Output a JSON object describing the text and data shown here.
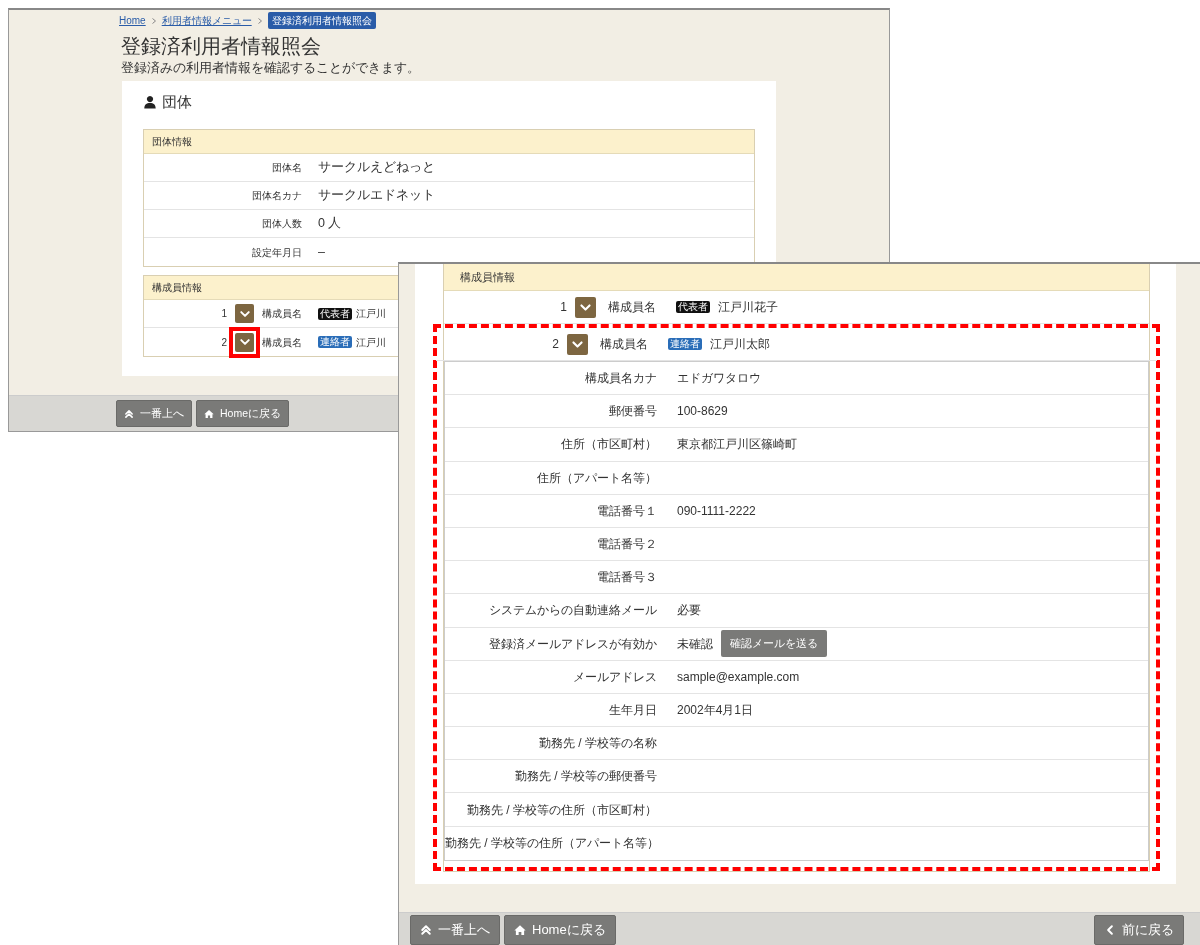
{
  "left_window": {
    "breadcrumbs": [
      {
        "label": "Home",
        "selected": false
      },
      {
        "label": "利用者情報メニュー",
        "selected": false
      },
      {
        "label": "登録済利用者情報照会",
        "selected": true
      }
    ],
    "title": "登録済利用者情報照会",
    "description": "登録済みの利用者情報を確認することができます。",
    "section_title": "団体",
    "group_panel": {
      "heading": "団体情報",
      "rows": [
        {
          "label": "団体名",
          "value": "サークルえどねっと"
        },
        {
          "label": "団体名カナ",
          "value": "サークルエドネット"
        },
        {
          "label": "団体人数",
          "value": "0 人"
        },
        {
          "label": "設定年月日",
          "value": "–"
        }
      ]
    },
    "members_panel": {
      "heading": "構成員情報",
      "members": [
        {
          "number": "1",
          "label": "構成員名",
          "role": "代表者",
          "kind": "representative",
          "name": "江戸川",
          "highlighted": false
        },
        {
          "number": "2",
          "label": "構成員名",
          "role": "連絡者",
          "kind": "contact",
          "name": "江戸川",
          "highlighted": true
        }
      ]
    },
    "footer_buttons": [
      {
        "label": "一番上へ",
        "kind": "top"
      },
      {
        "label": "Homeに戻る",
        "kind": "home"
      }
    ]
  },
  "right_window": {
    "members_panel": {
      "heading": "構成員情報",
      "members": [
        {
          "number": "1",
          "label": "構成員名",
          "role": "代表者",
          "kind": "representative",
          "name": "江戸川花子",
          "annotated": false
        },
        {
          "number": "2",
          "label": "構成員名",
          "role": "連絡者",
          "kind": "contact",
          "name": "江戸川太郎",
          "annotated": true,
          "details": [
            {
              "label": "構成員名カナ",
              "value": "エドガワタロウ"
            },
            {
              "label": "郵便番号",
              "value": "100-8629"
            },
            {
              "label": "住所（市区町村）",
              "value": "東京都江戸川区篠崎町"
            },
            {
              "label": "住所（アパート名等）"
            },
            {
              "label": "電話番号１",
              "value": "090-1111-2222"
            },
            {
              "label": "電話番号２"
            },
            {
              "label": "電話番号３"
            },
            {
              "label": "システムからの自動連絡メール",
              "value": "必要"
            },
            {
              "label": "登録済メールアドレスが有効か",
              "value": "未確認",
              "button": "確認メールを送る"
            },
            {
              "label": "メールアドレス",
              "value": "sample@example.com"
            },
            {
              "label": "生年月日",
              "value": "2002年4月1日"
            },
            {
              "label": "勤務先 / 学校等の名称"
            },
            {
              "label": "勤務先 / 学校等の郵便番号"
            },
            {
              "label": "勤務先 / 学校等の住所（市区町村）"
            },
            {
              "label": "勤務先 / 学校等の住所（アパート名等）"
            }
          ]
        }
      ]
    },
    "footer_buttons": [
      {
        "label": "一番上へ",
        "kind": "top"
      },
      {
        "label": "Homeに戻る",
        "kind": "home"
      },
      {
        "label": "前に戻る",
        "kind": "back"
      }
    ]
  }
}
